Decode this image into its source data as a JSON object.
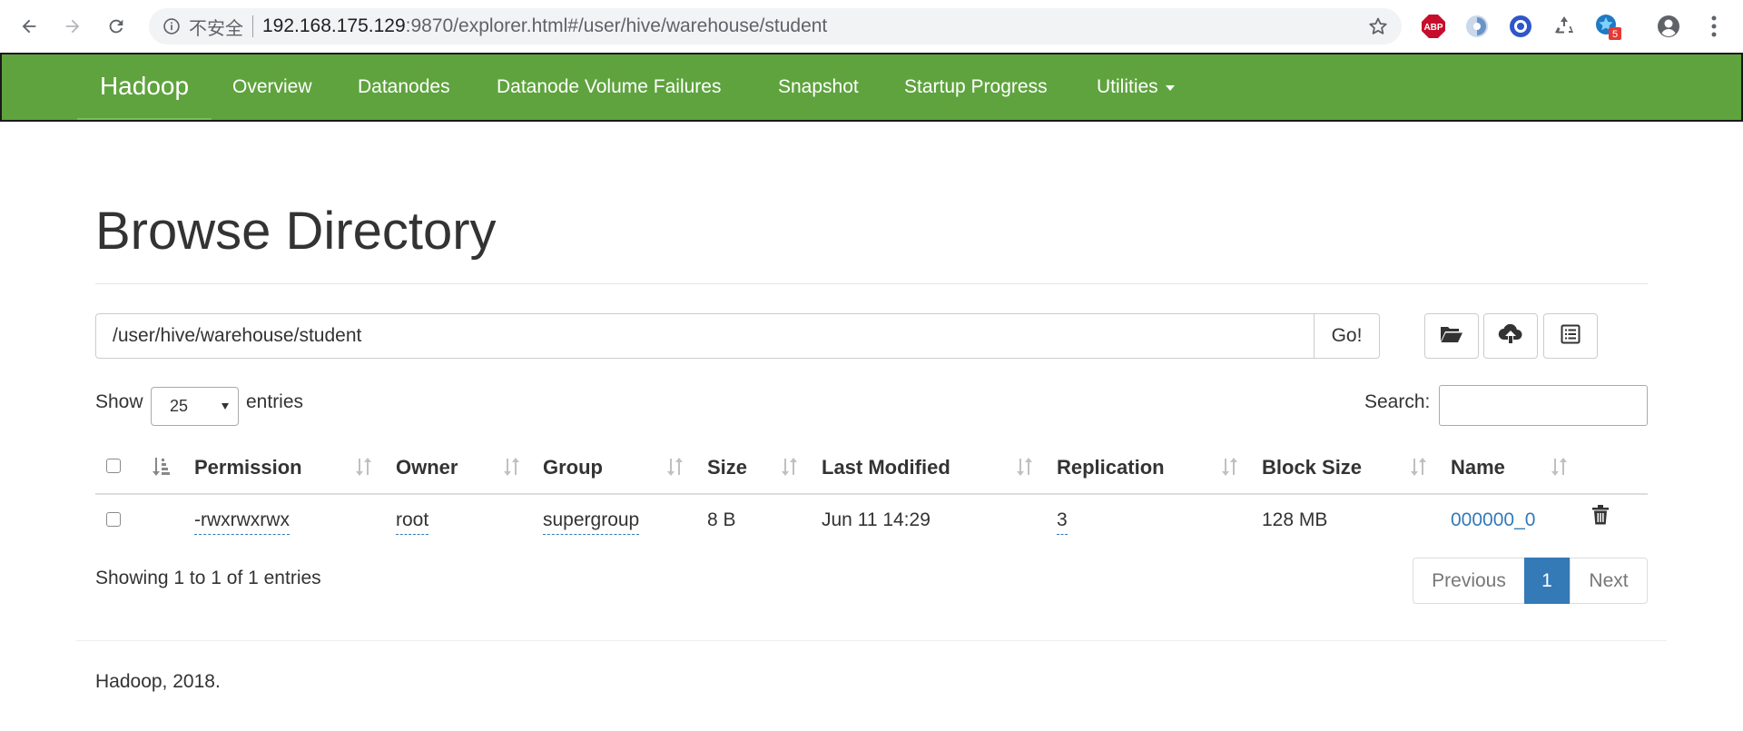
{
  "browser": {
    "security_label": "不安全",
    "url_host": "192.168.175.129",
    "url_rest": ":9870/explorer.html#/user/hive/warehouse/student",
    "extensions": [
      "abp-extension-icon",
      "speed-dial-extension-icon",
      "github-extension-icon",
      "recycle-extension-icon",
      "star-extension-icon"
    ],
    "extension_badge": "5",
    "abp_label": "ABP"
  },
  "navbar": {
    "brand": "Hadoop",
    "items": [
      {
        "label": "Overview"
      },
      {
        "label": "Datanodes"
      },
      {
        "label": "Datanode Volume Failures"
      },
      {
        "label": "Snapshot"
      },
      {
        "label": "Startup Progress"
      },
      {
        "label": "Utilities"
      }
    ],
    "color": "#5fa33e"
  },
  "page": {
    "title": "Browse Directory",
    "path_value": "/user/hive/warehouse/student",
    "go_label": "Go!",
    "show_label": "Show",
    "entries_value": "25",
    "entries_label": "entries",
    "search_label": "Search:",
    "search_value": ""
  },
  "table": {
    "headers": [
      "Permission",
      "Owner",
      "Group",
      "Size",
      "Last Modified",
      "Replication",
      "Block Size",
      "Name"
    ],
    "rows": [
      {
        "permission": "-rwxrwxrwx",
        "owner": "root",
        "group": "supergroup",
        "size": "8 B",
        "last_modified": "Jun 11 14:29",
        "replication": "3",
        "block_size": "128 MB",
        "name": "000000_0"
      }
    ]
  },
  "pagination": {
    "summary": "Showing 1 to 1 of 1 entries",
    "previous": "Previous",
    "current": "1",
    "next": "Next",
    "active_color": "#337ab7"
  },
  "footer": {
    "text": "Hadoop, 2018."
  }
}
